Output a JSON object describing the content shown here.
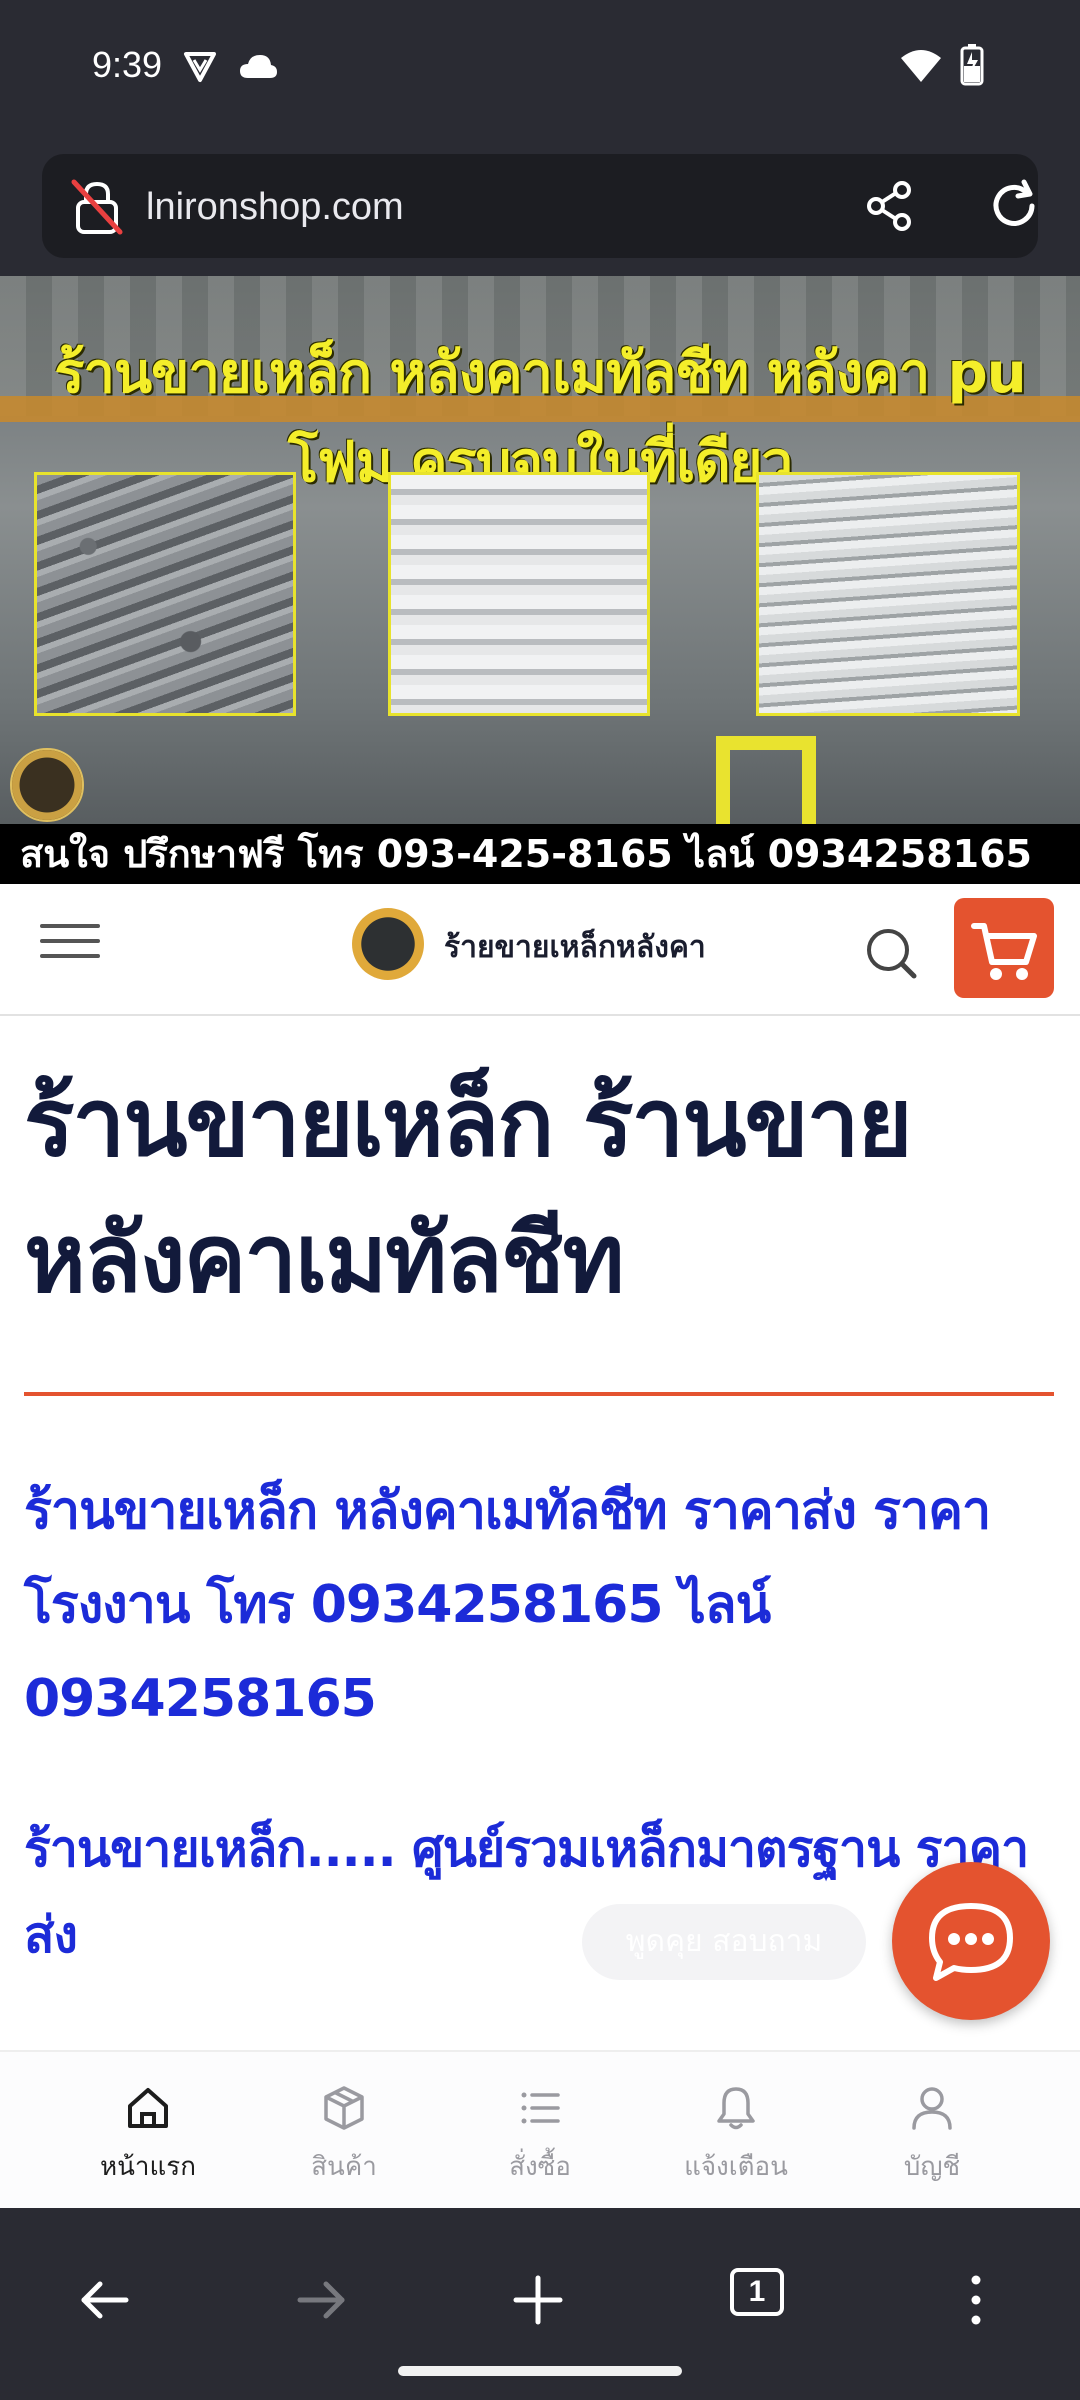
{
  "status_bar": {
    "time": "9:39",
    "icons": [
      "vpn-shield-icon",
      "cloud-icon",
      "wifi-icon",
      "battery-charging-icon"
    ]
  },
  "browser": {
    "url": "lnironshop.com",
    "icons": [
      "not-secure-lock-icon",
      "share-icon",
      "reload-icon"
    ],
    "tab_count": "1"
  },
  "banner": {
    "headline": "ร้านขายเหล็ก หลังคาเมทัลชีท หลังคา pu โฟม ครบจบในที่เดียว",
    "contact_strip": "สนใจ ปรึกษาฟรี โทร 093-425-8165 ไลน์ 0934258165"
  },
  "site_header": {
    "site_name": "ร้ายขายเหล็กหลังคา",
    "accent_color": "#e4532f"
  },
  "main": {
    "page_title": "ร้านขายเหล็ก ร้านขายหลังคาเมทัลชีท",
    "subheading_1": "ร้านขายเหล็ก หลังคาเมทัลชีท ราคาส่ง ราคาโรงงาน โทร 0934258165 ไลน์ 0934258165",
    "subheading_2": "ร้านขายเหล็ก..... ศูนย์รวมเหล็กมาตรฐาน ราคาส่ง",
    "chat_hint": "พูดคุย สอบถาม",
    "heading_color": "#121a3b",
    "link_color": "#1c2bd8"
  },
  "bottom_nav": {
    "items": [
      {
        "label": "หน้าแรก",
        "icon": "home-icon",
        "active": true
      },
      {
        "label": "สินค้า",
        "icon": "box-icon",
        "active": false
      },
      {
        "label": "สั่งซื้อ",
        "icon": "list-icon",
        "active": false
      },
      {
        "label": "แจ้งเตือน",
        "icon": "bell-icon",
        "active": false
      },
      {
        "label": "บัญชี",
        "icon": "user-icon",
        "active": false
      }
    ]
  }
}
